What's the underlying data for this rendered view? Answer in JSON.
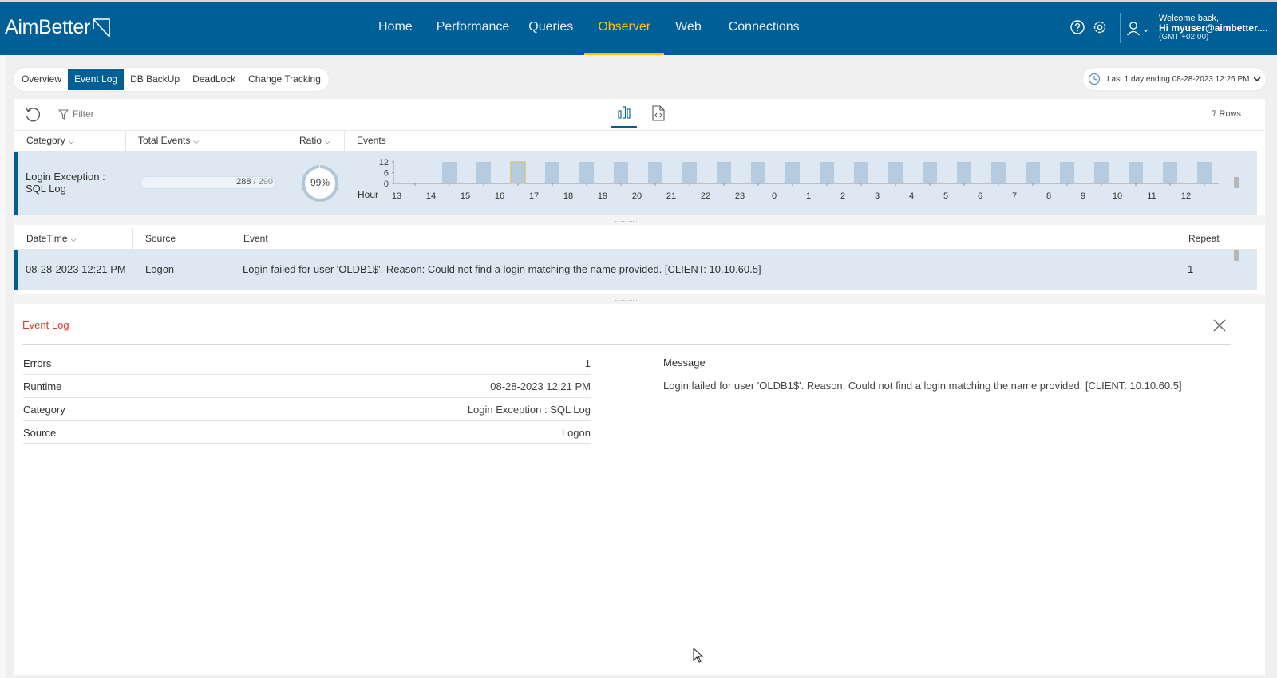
{
  "app": {
    "logo_text": "AimBetter"
  },
  "nav": {
    "items": [
      {
        "label": "Home"
      },
      {
        "label": "Performance"
      },
      {
        "label": "Queries"
      },
      {
        "label": "Observer",
        "active": true
      },
      {
        "label": "Web"
      },
      {
        "label": "Connections"
      }
    ]
  },
  "header": {
    "icons": [
      "help-icon",
      "settings-icon",
      "user-icon"
    ],
    "welcome": "Welcome back,",
    "user": "Hi myuser@aimbetter....",
    "timezone": "(GMT +02:00)"
  },
  "subtabs": [
    {
      "label": "Overview"
    },
    {
      "label": "Event Log",
      "active": true
    },
    {
      "label": "DB BackUp"
    },
    {
      "label": "DeadLock"
    },
    {
      "label": "Change Tracking"
    }
  ],
  "time_range": {
    "label": "Last 1 day ending  08-28-2023 12:26 PM"
  },
  "toolbar": {
    "filter_label": "Filter",
    "rows_count": "7 Rows"
  },
  "summary_table": {
    "columns": [
      "Category",
      "Total Events",
      "Ratio",
      "Events"
    ],
    "row": {
      "category_line1": "Login Exception :",
      "category_line2": "SQL Log",
      "total_value": "288",
      "total_sep": " / 290",
      "total_fraction": 0.993,
      "ratio": "99%",
      "ratio_fraction": 0.99
    }
  },
  "chart_data": {
    "type": "bar",
    "xlabel": "Hour",
    "categories": [
      "13",
      "14",
      "15",
      "16",
      "17",
      "18",
      "19",
      "20",
      "21",
      "22",
      "23",
      "0",
      "1",
      "2",
      "3",
      "4",
      "5",
      "6",
      "7",
      "8",
      "9",
      "10",
      "11",
      "12"
    ],
    "values": [
      0,
      12,
      12,
      12,
      12,
      12,
      12,
      12,
      12,
      12,
      12,
      12,
      12,
      12,
      12,
      12,
      12,
      12,
      12,
      12,
      12,
      12,
      12,
      12
    ],
    "y_ticks": [
      "12",
      "6",
      "0"
    ],
    "ylim": [
      0,
      12
    ],
    "bar_color": "#b5cbe0",
    "highlight_index": 3,
    "highlight_border": "#d4c48a"
  },
  "events_table": {
    "columns": [
      "DateTime",
      "Source",
      "Event",
      "Repeat"
    ],
    "rows": [
      {
        "datetime": "08-28-2023 12:21 PM",
        "source": "Logon",
        "event": "Login failed for user 'OLDB1$'. Reason: Could not find a login matching the name provided. [CLIENT: 10.10.60.5]",
        "repeat": "1"
      }
    ]
  },
  "detail": {
    "title": "Event Log",
    "fields": [
      {
        "key": "Errors",
        "value": "1"
      },
      {
        "key": "Runtime",
        "value": "08-28-2023 12:21 PM"
      },
      {
        "key": "Category",
        "value": "Login Exception : SQL Log"
      },
      {
        "key": "Source",
        "value": "Logon"
      }
    ],
    "message_label": "Message",
    "message": "Login failed for user 'OLDB1$'. Reason: Could not find a login matching the name provided. [CLIENT: 10.10.60.5]"
  },
  "colors": {
    "brand": "#005f97",
    "accent": "#ffc20e",
    "detail_title": "#e0362c",
    "row_selected": "#dde8f2"
  }
}
